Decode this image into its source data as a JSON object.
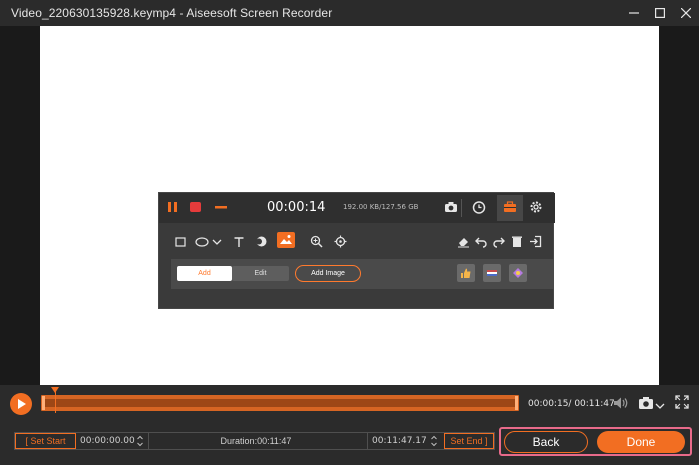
{
  "window": {
    "title": "Video_220630135928.keymp4  -  Aiseesoft Screen Recorder",
    "controls": [
      "minimize-icon",
      "maximize-icon",
      "close-icon"
    ]
  },
  "recorder_panel": {
    "elapsed": "00:00:14",
    "storage": "192.00 KB/127.56 GB",
    "top_icons": [
      "pause-icon",
      "stop-icon",
      "minimize-icon",
      "camera-icon",
      "clock-icon",
      "toolbox-icon",
      "gear-icon"
    ],
    "tools": [
      "rectangle-icon",
      "ellipse-icon",
      "chevron-down-icon",
      "text-icon",
      "highlight-icon",
      "image-icon",
      "zoom-icon",
      "target-icon",
      "eraser-icon",
      "undo-icon",
      "redo-icon",
      "trash-icon",
      "exit-icon"
    ],
    "tab_add": "Add",
    "tab_edit": "Edit",
    "add_image": "Add Image",
    "stickers": [
      "thumbs-up-icon",
      "flag-icon",
      "badge-icon"
    ]
  },
  "timeline": {
    "current_time": "00:00:15/ 00:11:47",
    "progress_fraction": 0.021
  },
  "trim": {
    "set_start": "[ Set Start",
    "start_time": "00:00:00.00",
    "duration": "Duration:00:11:47",
    "end_time": "00:11:47.17",
    "set_end": "Set End ]"
  },
  "actions": {
    "back": "Back",
    "done": "Done"
  },
  "colors": {
    "accent": "#f26e22",
    "background": "#2b2b2b",
    "highlight": "#e86a8a"
  }
}
